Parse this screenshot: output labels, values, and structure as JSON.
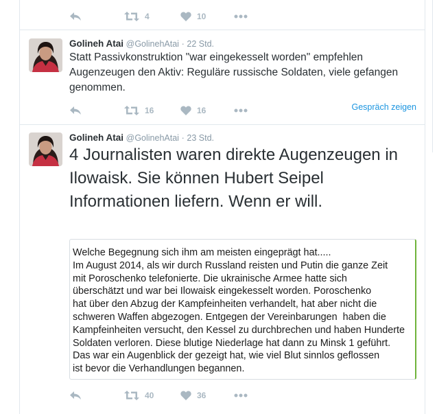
{
  "tweets": [
    {
      "actions": {
        "retweets": "4",
        "likes": "10"
      }
    },
    {
      "author": {
        "name": "Golineh Atai",
        "handle": "@GolinehAtai"
      },
      "separator": "·",
      "time": "22 Std.",
      "text": "Statt Passivkonstruktion \"war eingekesselt worden\" empfehlen Augenzeugen den Aktiv: Reguläre russische Soldaten, viele gefangen genommen.",
      "actions": {
        "retweets": "16",
        "likes": "16"
      },
      "conversation_link": "Gespräch zeigen"
    },
    {
      "author": {
        "name": "Golineh Atai",
        "handle": "@GolinehAtai"
      },
      "separator": "·",
      "time": "23 Std.",
      "text": "4 Journalisten waren direkte Augenzeugen in Ilowaisk. Sie können Hubert Seipel Informationen liefern. Wenn er will.",
      "image_text": "Welche Begegnung sich ihm am meisten eingeprägt hat.....\nIm August 2014, als wir durch Russland reisten und Putin die ganze Zeit\nmit Poroschenko telefonierte. Die ukrainische Armee hatte sich\nüberschätzt und war bei Ilowaisk eingekesselt worden. Poroschenko\nhat über den Abzug der Kampfeinheiten verhandelt, hat aber nicht die\nschweren Waffen abgezogen. Entgegen der Vereinbarungen  haben die\nKampfeinheiten versucht, den Kessel zu durchbrechen und haben Hunderte\nSoldaten verloren. Diese blutige Niederlage hat dann zu Minsk 1 geführt.\nDas war ein Augenblick der gezeigt hat, wie viel Blut sinnlos geflossen\nist bevor die Verhandlungen begannen.",
      "actions": {
        "retweets": "40",
        "likes": "36"
      }
    }
  ],
  "icons": {
    "reply": "reply-icon",
    "retweet": "retweet-icon",
    "like": "heart-icon",
    "more": "more-icon",
    "avatar": "avatar"
  },
  "colors": {
    "icon_gray": "#aab8c2",
    "link_blue": "#1b95e0",
    "name_text": "#292f33",
    "meta_gray": "#8899a6",
    "image_border_accent": "#6fb33a"
  }
}
